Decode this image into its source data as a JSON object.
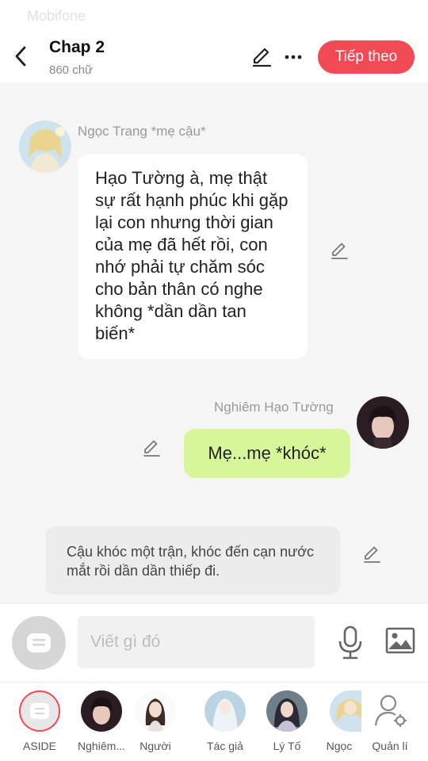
{
  "status": {
    "carrier": "Mobifone"
  },
  "header": {
    "title": "Chap 2",
    "word_count": "860 chữ",
    "next_label": "Tiếp theo"
  },
  "messages": [
    {
      "speaker": "Ngọc Trang *mẹ cậu*",
      "text": "Hạo Tường à, mẹ thật sự rất hạnh phúc khi gặp lại con nhưng thời gian của mẹ đã hết rồi, con nhớ phải tự chăm sóc cho bản thân có nghe không *dần dần tan biến*"
    },
    {
      "speaker": "Nghiêm Hạo Tường",
      "text": "Mẹ...mẹ *khóc*"
    },
    {
      "narration": "Cậu khóc một trận, khóc đến cạn nước mắt rồi dần dần thiếp đi."
    }
  ],
  "composer": {
    "placeholder": "Viết gì đó"
  },
  "characters": [
    {
      "label": "ASIDE"
    },
    {
      "label": "Nghiêm..."
    },
    {
      "label": "Người"
    },
    {
      "label": "Tác giả"
    },
    {
      "label": "Lý Tố"
    },
    {
      "label": "Ngọc"
    },
    {
      "label": "Quản lí"
    }
  ],
  "colors": {
    "accent": "#f24a55",
    "my_bubble": "#d7f599",
    "background": "#f5f5f5"
  }
}
